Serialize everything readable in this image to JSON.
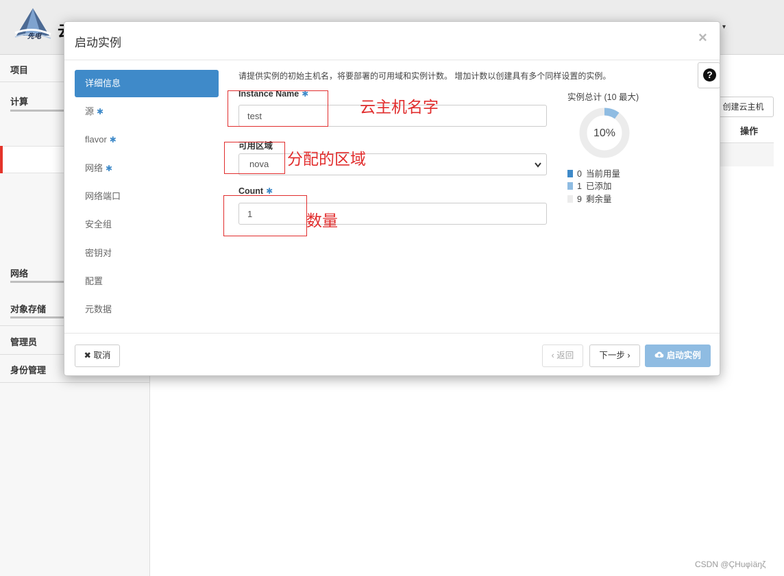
{
  "header": {
    "logo_text": "先电",
    "brand_glyph": "云",
    "user_caret": "▾"
  },
  "sidebar": {
    "sections": [
      {
        "label": "项目"
      },
      {
        "label": "计算"
      },
      {
        "label": "网络"
      },
      {
        "label": "对象存储"
      },
      {
        "label": "管理员"
      },
      {
        "label": "身份管理"
      }
    ]
  },
  "main": {
    "create_button_label": "创建云主机",
    "table_header_actions": "操作",
    "help_glyph": "?"
  },
  "modal": {
    "title": "启动实例",
    "close_glyph": "×",
    "nav": [
      {
        "label": "详细信息",
        "required": false
      },
      {
        "label": "源",
        "required": true
      },
      {
        "label": "flavor",
        "required": true
      },
      {
        "label": "网络",
        "required": true
      },
      {
        "label": "网络端口",
        "required": false
      },
      {
        "label": "安全组",
        "required": false
      },
      {
        "label": "密钥对",
        "required": false
      },
      {
        "label": "配置",
        "required": false
      },
      {
        "label": "元数据",
        "required": false
      }
    ],
    "required_marker": "✱",
    "help_text": "请提供实例的初始主机名，将要部署的可用域和实例计数。 增加计数以创建具有多个同样设置的实例。",
    "fields": {
      "instance_name": {
        "label": "Instance Name",
        "value": "test"
      },
      "availability_zone": {
        "label": "可用区域",
        "value": "nova"
      },
      "count": {
        "label": "Count",
        "value": "1"
      }
    },
    "quota": {
      "title": "实例总计 (10 最大)",
      "percent_label": "10%",
      "percent": 10,
      "legend": [
        {
          "num": "0",
          "label": "当前用量",
          "color": "#3f8ac9"
        },
        {
          "num": "1",
          "label": "已添加",
          "color": "#8fbce2"
        },
        {
          "num": "9",
          "label": "剩余量",
          "color": "#ececec"
        }
      ]
    },
    "footer": {
      "cancel_label": "取消",
      "back_label": "‹ 返回",
      "next_label": "下一步 ›",
      "launch_label": "启动实例"
    }
  },
  "annotations": {
    "name_note": "云主机名字",
    "zone_note": "分配的区域",
    "count_note": "数量"
  },
  "watermark": "CSDN @ÇHuφìäŋζ",
  "colors": {
    "accent": "#3f8ac9",
    "accent_light": "#8fbce2",
    "annotation": "#e12d2d",
    "sidebar_active_bar": "#e4342a"
  }
}
